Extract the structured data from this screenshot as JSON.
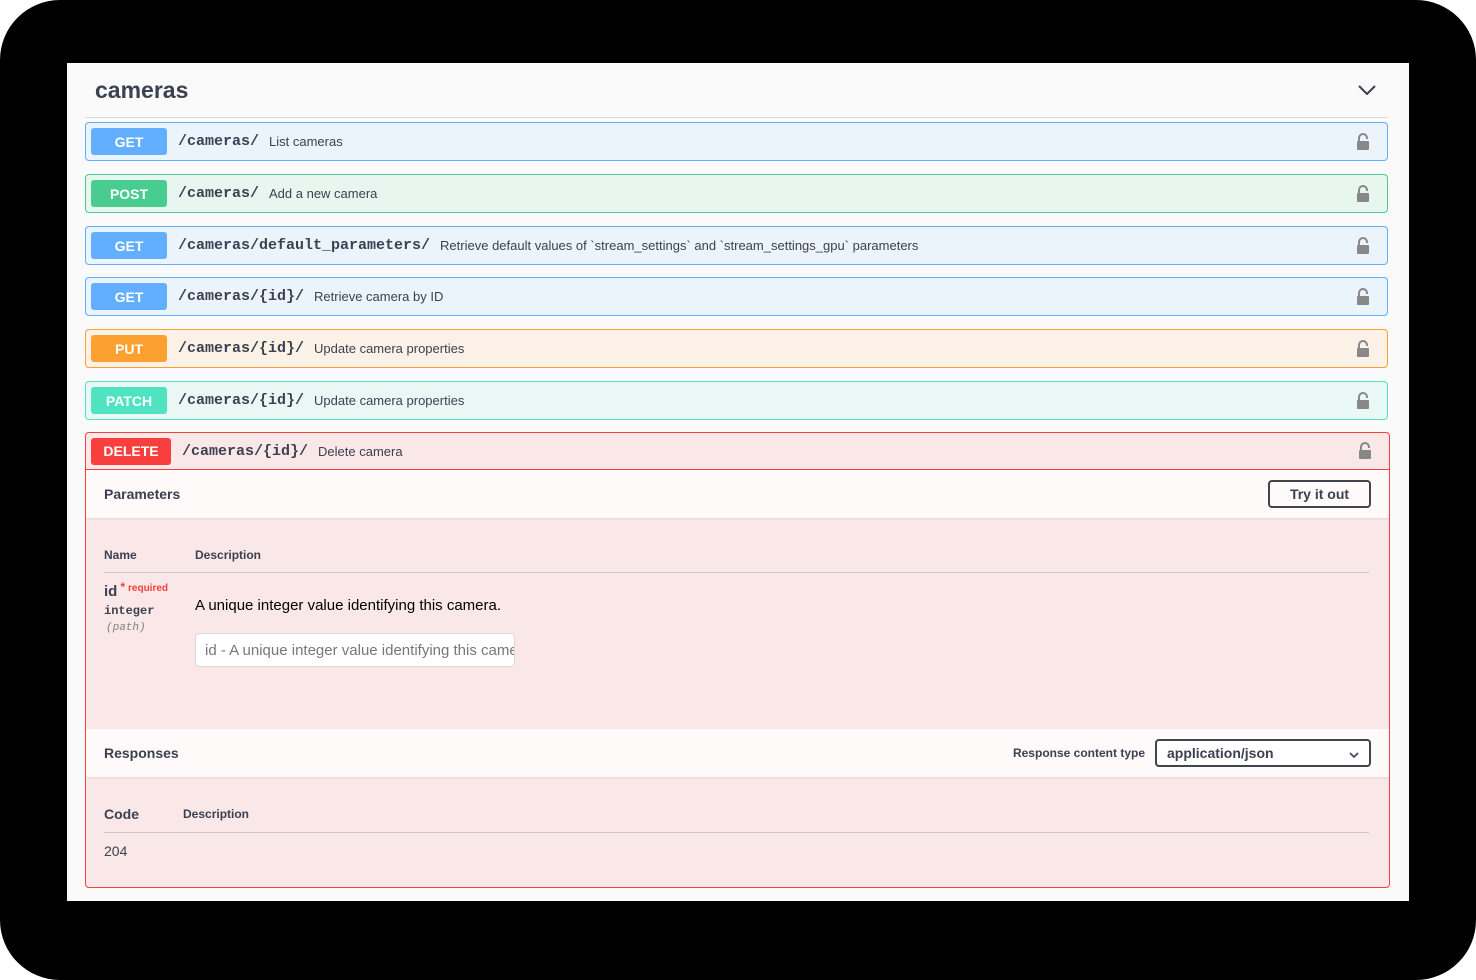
{
  "tag": {
    "title": "cameras"
  },
  "operations": [
    {
      "method": "GET",
      "path": "/cameras/",
      "summary": "List cameras"
    },
    {
      "method": "POST",
      "path": "/cameras/",
      "summary": "Add a new camera"
    },
    {
      "method": "GET",
      "path": "/cameras/default_parameters/",
      "summary": "Retrieve default values of `stream_settings` and `stream_settings_gpu` parameters"
    },
    {
      "method": "GET",
      "path": "/cameras/{id}/",
      "summary": "Retrieve camera by ID"
    },
    {
      "method": "PUT",
      "path": "/cameras/{id}/",
      "summary": "Update camera properties"
    },
    {
      "method": "PATCH",
      "path": "/cameras/{id}/",
      "summary": "Update camera properties"
    },
    {
      "method": "DELETE",
      "path": "/cameras/{id}/",
      "summary": "Delete camera"
    }
  ],
  "delete_detail": {
    "parameters_title": "Parameters",
    "try_label": "Try it out",
    "col_name": "Name",
    "col_description": "Description",
    "param": {
      "name": "id",
      "star": "*",
      "required": "required",
      "type": "integer",
      "in": "(path)",
      "description": "A unique integer value identifying this camera.",
      "placeholder": "id - A unique integer value identifying this camera."
    },
    "responses_title": "Responses",
    "content_type_label": "Response content type",
    "content_type_value": "application/json",
    "resp_col_code": "Code",
    "resp_col_description": "Description",
    "response_code": "204"
  },
  "colors": {
    "get": "#61affe",
    "post": "#49cc90",
    "put": "#fca130",
    "patch": "#50e3c2",
    "delete": "#f93e3e"
  }
}
